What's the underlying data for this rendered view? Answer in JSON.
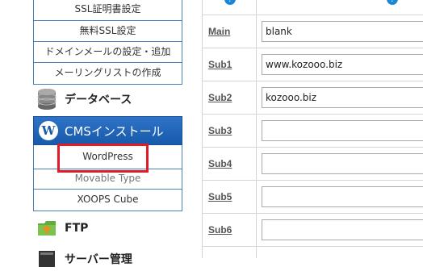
{
  "sidebar": {
    "server_submenu": [
      {
        "label": "SSL証明書設定"
      },
      {
        "label": "無料SSL設定"
      },
      {
        "label": "ドメインメールの設定・追加"
      },
      {
        "label": "メーリングリストの作成"
      }
    ],
    "database": {
      "label": "データベース",
      "icon": "database-icon"
    },
    "cms": {
      "label": "CMSインストール",
      "icon": "wordpress-icon",
      "items": [
        {
          "label": "WordPress"
        },
        {
          "label": "Movable Type"
        },
        {
          "label": "XOOPS Cube"
        }
      ]
    },
    "ftp": {
      "label": "FTP",
      "icon": "ftp-icon"
    },
    "server_management": {
      "label": "サーバー管理",
      "icon": "server-icon"
    }
  },
  "table": {
    "rows": [
      {
        "label": "Main",
        "value": ""
      },
      {
        "label": "Sub1",
        "value": ""
      },
      {
        "label": "Sub2",
        "value": ""
      },
      {
        "label": "Sub3",
        "value": ""
      },
      {
        "label": "Sub4",
        "value": ""
      },
      {
        "label": "Sub5",
        "value": ""
      },
      {
        "label": "Sub6",
        "value": ""
      }
    ],
    "row_values": [
      "blank",
      "www.kozooo.biz",
      "kozooo.biz",
      "",
      "",
      "",
      ""
    ]
  },
  "colors": {
    "accent": "#1e63b5",
    "highlight": "#e11c2a",
    "link_help": "#1a87d6"
  }
}
